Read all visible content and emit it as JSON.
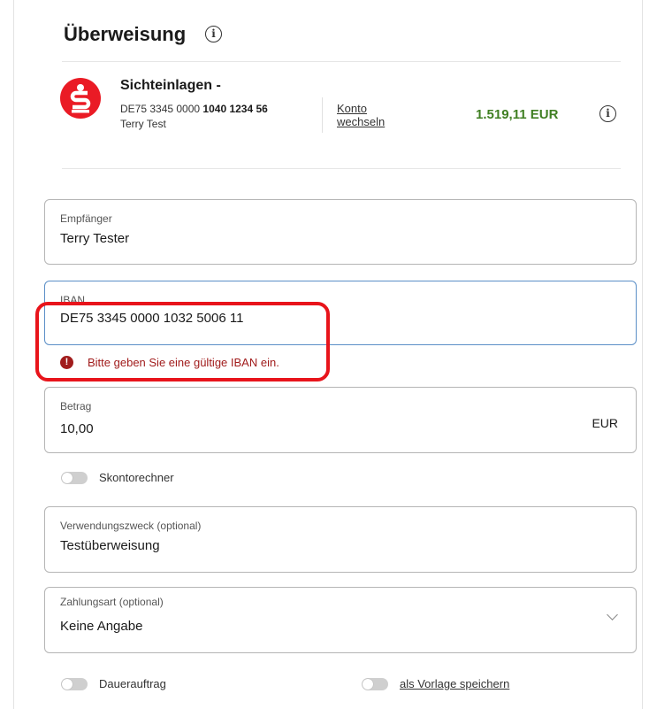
{
  "page": {
    "title": "Überweisung"
  },
  "account": {
    "name": "Sichteinlagen -",
    "iban_prefix": "DE75 3345 0000 ",
    "iban_suffix": "1040 1234 56",
    "owner": "Terry Test",
    "switch_label": "Konto wechseln",
    "balance": "1.519,11 EUR",
    "balance_color": "#3f7f22",
    "brand_color": "#ea1b25"
  },
  "form": {
    "recipient": {
      "label": "Empfänger",
      "value": "Terry Tester"
    },
    "iban": {
      "label": "IBAN",
      "value": "DE75 3345 0000 1032 5006 11",
      "error": "Bitte geben Sie eine gültige IBAN ein.",
      "error_icon": "!",
      "error_color": "#a11c1c"
    },
    "amount": {
      "label": "Betrag",
      "value": "10,00",
      "currency": "EUR"
    },
    "skonto": {
      "label": "Skontorechner",
      "on": false
    },
    "purpose": {
      "label": "Verwendungszweck (optional)",
      "value": "Testüberweisung"
    },
    "payment_type": {
      "label": "Zahlungsart (optional)",
      "value": "Keine Angabe"
    },
    "standing_order": {
      "label": "Dauerauftrag",
      "on": false
    },
    "save_template": {
      "label": "als Vorlage speichern",
      "on": false
    }
  },
  "annotation": {
    "highlight_color": "#e8141b"
  }
}
